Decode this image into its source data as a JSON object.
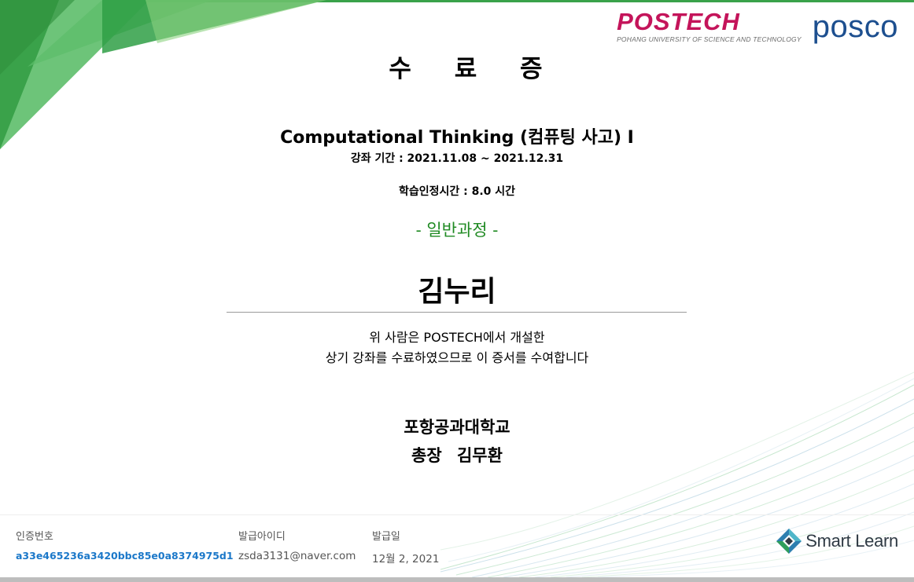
{
  "logos": {
    "postech_name": "POSTECH",
    "postech_subtitle": "POHANG UNIVERSITY OF SCIENCE AND TECHNOLOGY",
    "posco_name": "posco",
    "smartlearn_name": "Smart Learn"
  },
  "certificate": {
    "title": "수 료 증",
    "course_title": "Computational Thinking (컴퓨팅 사고)  I",
    "course_period": "강좌 기간 : 2021.11.08 ~ 2021.12.31",
    "study_hours": "학습인정시간 : 8.0 시간",
    "course_type": "- 일반과정 -",
    "recipient_name": "김누리",
    "statement_line1": "위 사람은 POSTECH에서 개설한",
    "statement_line2": "상기 강좌를 수료하였으므로 이 증서를 수여합니다",
    "issuer": "포항공과대학교",
    "signer": "총장  김무환"
  },
  "footer": {
    "cert_number_label": "인증번호",
    "cert_number_value": "a33e465236a3420bbc85e0a8374975d1",
    "issuer_id_label": "발급아이디",
    "issuer_id_value": "zsda3131@naver.com",
    "issue_date_label": "발급일",
    "issue_date_value": "12월 2, 2021"
  },
  "colors": {
    "postech_red": "#c4145a",
    "posco_blue": "#1d4f8f",
    "course_type_green": "#1f8a22",
    "cert_number_blue": "#1b78c9",
    "corner_green": "#3aa24a"
  },
  "icons": {
    "smartlearn_logo": "smartlearn-diamond-icon"
  }
}
